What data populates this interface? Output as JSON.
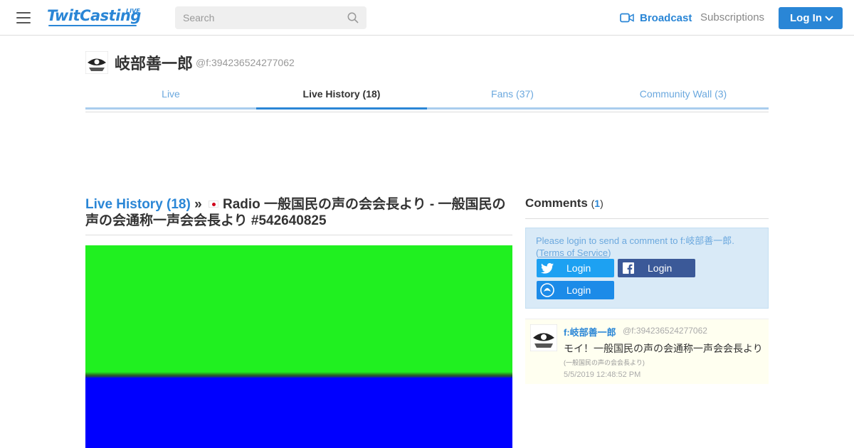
{
  "header": {
    "logo_text": "TwitCasting",
    "logo_sup": "LIVE",
    "search_placeholder": "Search",
    "broadcast_label": "Broadcast",
    "subscriptions_label": "Subscriptions",
    "login_label": "Log In"
  },
  "profile": {
    "name": "岐部善一郎",
    "id": "@f:394236524277062"
  },
  "tabs": [
    {
      "label": "Live",
      "active": false
    },
    {
      "label": "Live History (18)",
      "active": true
    },
    {
      "label": "Fans (37)",
      "active": false
    },
    {
      "label": "Community Wall (3)",
      "active": false
    }
  ],
  "main": {
    "history_link": "Live History (18)",
    "separator": "»",
    "title": "Radio 一般国民の声の会会長より - 一般国民の声の会通称一声会会長より #542640825"
  },
  "comments": {
    "heading": "Comments",
    "count": "1",
    "login_message": "Please login to send a comment to f:岐部善一郎.",
    "terms_label": "Terms of Service",
    "twitter_login": "Login",
    "facebook_login": "Login",
    "twitcasting_login": "Login",
    "items": [
      {
        "name": "f:岐部善一郎",
        "id": "@f:394236524277062",
        "text": "モイ！一般国民の声の会通称一声会会長より",
        "sub": "(一般国民の声の会会長より)",
        "time": "5/5/2019 12:48:52 PM"
      }
    ]
  },
  "colors": {
    "accent": "#2a86d6",
    "twitter": "#1da1f2",
    "facebook": "#3b5998",
    "video_top": "#20f020",
    "video_bottom": "#0000ff"
  }
}
